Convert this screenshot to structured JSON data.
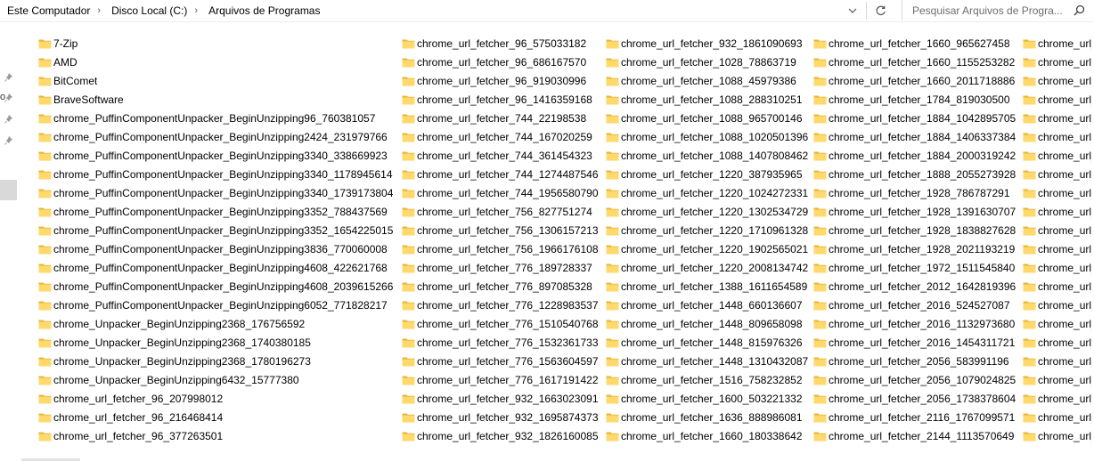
{
  "address": {
    "crumbs": [
      "Este Computador",
      "Disco Local (C:)",
      "Arquivos de Programas"
    ],
    "dropdown_icon": "chevron-down-icon",
    "refresh_icon": "refresh-icon"
  },
  "search": {
    "placeholder": "Pesquisar Arquivos de Progra...",
    "icon": "search-icon"
  },
  "navpane": {
    "partial_label": "o"
  },
  "colors": {
    "folder": "#ffd96b",
    "folder_dark": "#e8b737",
    "selected_nav": "#d9d9d9"
  },
  "files": {
    "columns": [
      [
        "7-Zip",
        "AMD",
        "BitComet",
        "BraveSoftware",
        "chrome_PuffinComponentUnpacker_BeginUnzipping96_760381057",
        "chrome_PuffinComponentUnpacker_BeginUnzipping2424_231979766",
        "chrome_PuffinComponentUnpacker_BeginUnzipping3340_338669923",
        "chrome_PuffinComponentUnpacker_BeginUnzipping3340_1178945614",
        "chrome_PuffinComponentUnpacker_BeginUnzipping3340_1739173804",
        "chrome_PuffinComponentUnpacker_BeginUnzipping3352_788437569",
        "chrome_PuffinComponentUnpacker_BeginUnzipping3352_1654225015",
        "chrome_PuffinComponentUnpacker_BeginUnzipping3836_770060008",
        "chrome_PuffinComponentUnpacker_BeginUnzipping4608_422621768",
        "chrome_PuffinComponentUnpacker_BeginUnzipping4608_2039615266",
        "chrome_PuffinComponentUnpacker_BeginUnzipping6052_771828217",
        "chrome_Unpacker_BeginUnzipping2368_176756592",
        "chrome_Unpacker_BeginUnzipping2368_1740380185",
        "chrome_Unpacker_BeginUnzipping2368_1780196273",
        "chrome_Unpacker_BeginUnzipping6432_15777380",
        "chrome_url_fetcher_96_207998012",
        "chrome_url_fetcher_96_216468414",
        "chrome_url_fetcher_96_377263501"
      ],
      [
        "chrome_url_fetcher_96_575033182",
        "chrome_url_fetcher_96_686167570",
        "chrome_url_fetcher_96_919030996",
        "chrome_url_fetcher_96_1416359168",
        "chrome_url_fetcher_744_22198538",
        "chrome_url_fetcher_744_167020259",
        "chrome_url_fetcher_744_361454323",
        "chrome_url_fetcher_744_1274487546",
        "chrome_url_fetcher_744_1956580790",
        "chrome_url_fetcher_756_827751274",
        "chrome_url_fetcher_756_1306157213",
        "chrome_url_fetcher_756_1966176108",
        "chrome_url_fetcher_776_189728337",
        "chrome_url_fetcher_776_897085328",
        "chrome_url_fetcher_776_1228983537",
        "chrome_url_fetcher_776_1510540768",
        "chrome_url_fetcher_776_1532361733",
        "chrome_url_fetcher_776_1563604597",
        "chrome_url_fetcher_776_1617191422",
        "chrome_url_fetcher_932_1663023091",
        "chrome_url_fetcher_932_1695874373",
        "chrome_url_fetcher_932_1826160085"
      ],
      [
        "chrome_url_fetcher_932_1861090693",
        "chrome_url_fetcher_1028_78863719",
        "chrome_url_fetcher_1088_45979386",
        "chrome_url_fetcher_1088_288310251",
        "chrome_url_fetcher_1088_965700146",
        "chrome_url_fetcher_1088_1020501396",
        "chrome_url_fetcher_1088_1407808462",
        "chrome_url_fetcher_1220_387935965",
        "chrome_url_fetcher_1220_1024272331",
        "chrome_url_fetcher_1220_1302534729",
        "chrome_url_fetcher_1220_1710961328",
        "chrome_url_fetcher_1220_1902565021",
        "chrome_url_fetcher_1220_2008134742",
        "chrome_url_fetcher_1388_1611654589",
        "chrome_url_fetcher_1448_660136607",
        "chrome_url_fetcher_1448_809658098",
        "chrome_url_fetcher_1448_815976326",
        "chrome_url_fetcher_1448_1310432087",
        "chrome_url_fetcher_1516_758232852",
        "chrome_url_fetcher_1600_503221332",
        "chrome_url_fetcher_1636_888986081",
        "chrome_url_fetcher_1660_180338642"
      ],
      [
        "chrome_url_fetcher_1660_965627458",
        "chrome_url_fetcher_1660_1155253282",
        "chrome_url_fetcher_1660_2011718886",
        "chrome_url_fetcher_1784_819030500",
        "chrome_url_fetcher_1884_1042895705",
        "chrome_url_fetcher_1884_1406337384",
        "chrome_url_fetcher_1884_2000319242",
        "chrome_url_fetcher_1888_2055273928",
        "chrome_url_fetcher_1928_786787291",
        "chrome_url_fetcher_1928_1391630707",
        "chrome_url_fetcher_1928_1838827628",
        "chrome_url_fetcher_1928_2021193219",
        "chrome_url_fetcher_1972_1511545840",
        "chrome_url_fetcher_2012_1642819396",
        "chrome_url_fetcher_2016_524527087",
        "chrome_url_fetcher_2016_1132973680",
        "chrome_url_fetcher_2016_1454311721",
        "chrome_url_fetcher_2056_583991196",
        "chrome_url_fetcher_2056_1079024825",
        "chrome_url_fetcher_2056_1738378604",
        "chrome_url_fetcher_2116_1767099571",
        "chrome_url_fetcher_2144_1113570649"
      ],
      [
        "chrome_url_",
        "chrome_url_",
        "chrome_url_",
        "chrome_url_",
        "chrome_url_",
        "chrome_url_",
        "chrome_url_",
        "chrome_url_",
        "chrome_url_",
        "chrome_url_",
        "chrome_url_",
        "chrome_url_",
        "chrome_url_",
        "chrome_url_",
        "chrome_url_",
        "chrome_url_",
        "chrome_url_",
        "chrome_url_",
        "chrome_url_",
        "chrome_url_",
        "chrome_url_",
        "chrome_url_"
      ]
    ]
  }
}
